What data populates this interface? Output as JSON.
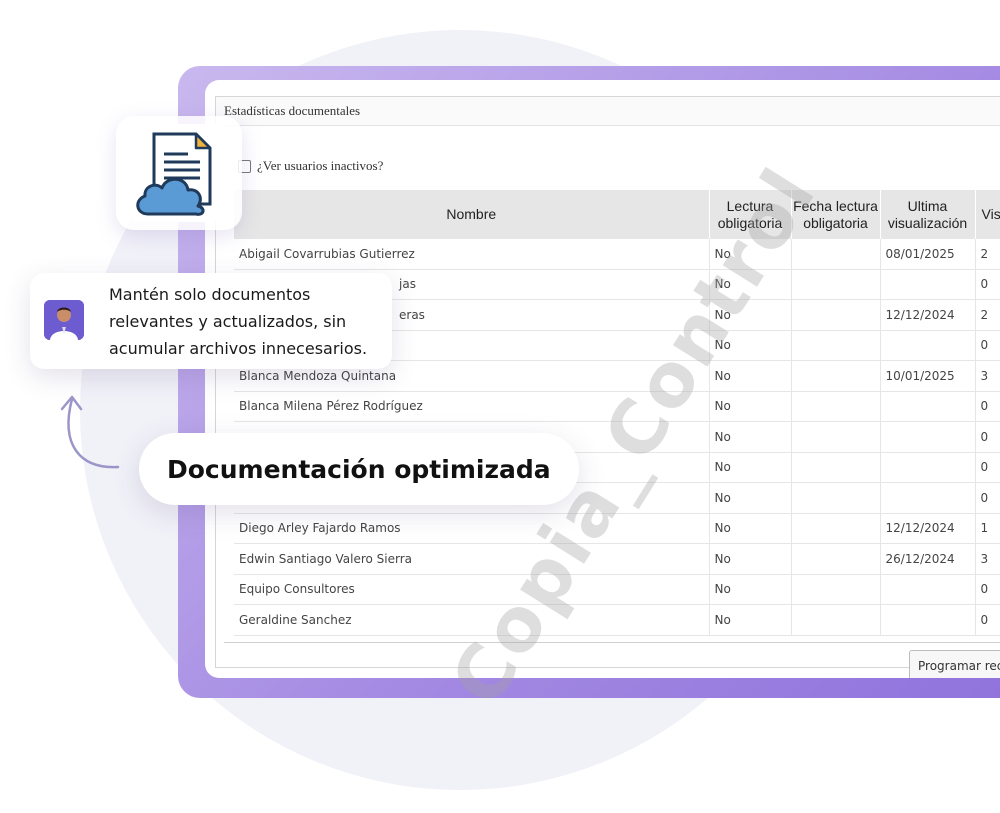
{
  "panel": {
    "title": "Estadísticas documentales",
    "inactive_label": "¿Ver usuarios inactivos?",
    "program_button": "Programar recordatorio"
  },
  "table": {
    "headers": [
      "Nombre",
      "Lectura obligatoria",
      "Fecha lectura obligatoria",
      "Ultima visualización",
      "Visualizaciones"
    ],
    "rows": [
      [
        "Abigail Covarrubias Gutierrez",
        "No",
        "",
        "08/01/2025",
        "2"
      ],
      [
        "",
        "No",
        "",
        "",
        "0"
      ],
      [
        "",
        "No",
        "",
        "12/12/2024",
        "2"
      ],
      [
        "",
        "No",
        "",
        "",
        "0"
      ],
      [
        "Blanca Mendoza Quintana",
        "No",
        "",
        "10/01/2025",
        "3"
      ],
      [
        "Blanca Milena Pérez Rodríguez",
        "No",
        "",
        "",
        "0"
      ],
      [
        "",
        "No",
        "",
        "",
        "0"
      ],
      [
        "",
        "No",
        "",
        "",
        "0"
      ],
      [
        "",
        "No",
        "",
        "",
        "0"
      ],
      [
        "Diego Arley Fajardo Ramos",
        "No",
        "",
        "12/12/2024",
        "1"
      ],
      [
        "Edwin Santiago Valero Sierra",
        "No",
        "",
        "26/12/2024",
        "3"
      ],
      [
        "Equipo Consultores",
        "No",
        "",
        "",
        "0"
      ],
      [
        "Geraldine Sanchez",
        "No",
        "",
        "",
        "0"
      ]
    ],
    "partial_names": [
      "jas",
      "eras"
    ]
  },
  "watermark": "Copia_Control",
  "tip": {
    "text": "Mantén solo documentos relevantes y actualizados, sin acumular archivos innecesarios."
  },
  "pill": {
    "label": "Documentación optimizada"
  },
  "icons": {
    "document": "document-cloud-icon",
    "avatar": "avatar",
    "arrow": "curved-arrow-icon"
  },
  "colors": {
    "frame": "#a58be3",
    "header_bg": "#e6e6e6",
    "cloud": "#5b9bd5"
  }
}
